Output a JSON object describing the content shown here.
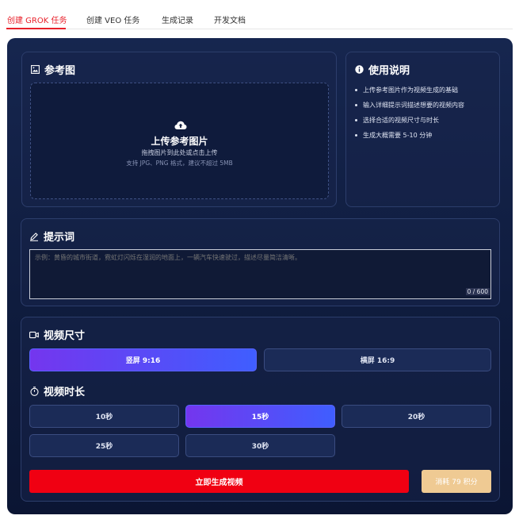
{
  "tabs": [
    {
      "label": "创建 GROK 任务",
      "active": true
    },
    {
      "label": "创建 VEO 任务",
      "active": false
    },
    {
      "label": "生成记录",
      "active": false
    },
    {
      "label": "开发文档",
      "active": false
    }
  ],
  "reference": {
    "title": "参考图",
    "upload_title": "上传参考图片",
    "upload_subtitle": "拖拽图片到此处或点击上传",
    "upload_hint": "支持 JPG、PNG 格式，建议不超过 5MB"
  },
  "instructions": {
    "title": "使用说明",
    "items": [
      "上传参考图片作为视频生成的基础",
      "输入详细提示词描述想要的视频内容",
      "选择合适的视频尺寸与时长",
      "生成大概需要 5-10 分钟"
    ]
  },
  "prompt": {
    "title": "提示词",
    "placeholder": "示例：黄昏的城市街道，霓虹灯闪烁在湿润的地面上，一辆汽车快速驶过，描述尽量简洁清晰。",
    "value": "",
    "counter": "0 / 600"
  },
  "video_size": {
    "title": "视频尺寸",
    "options": [
      "竖屏 9:16",
      "横屏 16:9"
    ],
    "selected": "竖屏 9:16"
  },
  "video_duration": {
    "title": "视频时长",
    "options": [
      "10秒",
      "15秒",
      "20秒",
      "25秒",
      "30秒"
    ],
    "selected": "15秒"
  },
  "actions": {
    "generate_label": "立即生成视频",
    "cost_label": "消耗 79 积分"
  },
  "colors": {
    "accent_red": "#e8202a",
    "generate_red": "#f00012",
    "cost_gold": "#efca93",
    "selected_gradient_start": "#7436ee",
    "selected_gradient_end": "#3f5eff",
    "panel_bg": "#16264f"
  },
  "icons": {
    "reference": "image-icon",
    "upload": "cloud-upload-icon",
    "instructions": "info-icon",
    "prompt": "pencil-icon",
    "size": "video-camera-icon",
    "duration": "stopwatch-icon"
  }
}
